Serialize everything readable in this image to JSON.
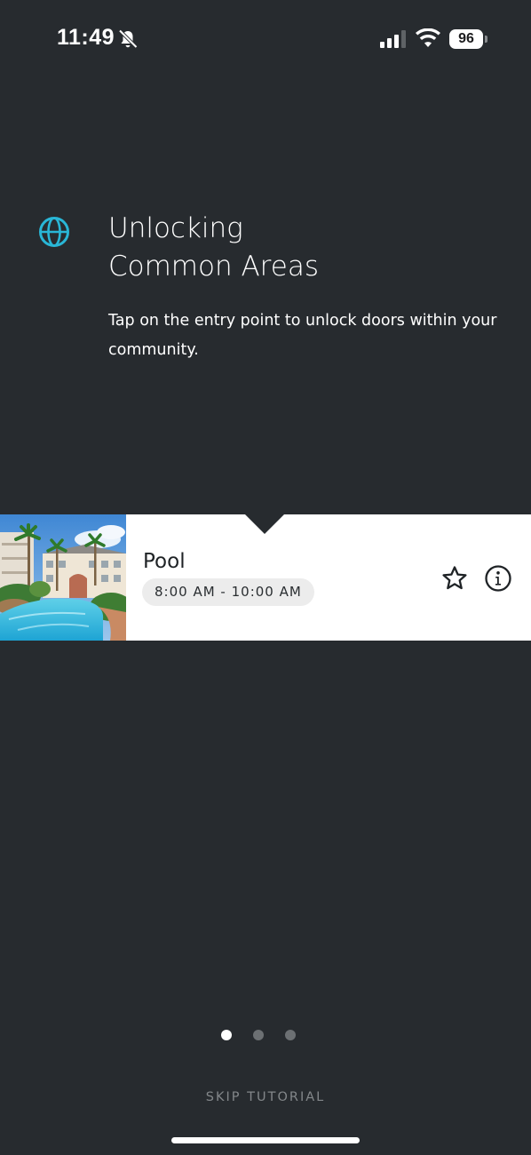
{
  "status_bar": {
    "time": "11:49",
    "battery": "96",
    "icons": [
      "bell-slash-icon",
      "cellular-signal-icon",
      "wifi-icon",
      "battery-icon"
    ]
  },
  "tutorial": {
    "icon": "globe-icon",
    "accent_color": "#29b6d6",
    "title": "Unlocking\nCommon Areas",
    "description": "Tap on the entry point to unlock doors within your community."
  },
  "entry_card": {
    "name": "Pool",
    "hours": "8:00 AM - 10:00 AM",
    "image": "pool-photo",
    "actions": [
      "star-icon",
      "info-icon"
    ]
  },
  "pager": {
    "total": 3,
    "active_index": 0
  },
  "footer": {
    "skip_label": "SKIP TUTORIAL"
  }
}
